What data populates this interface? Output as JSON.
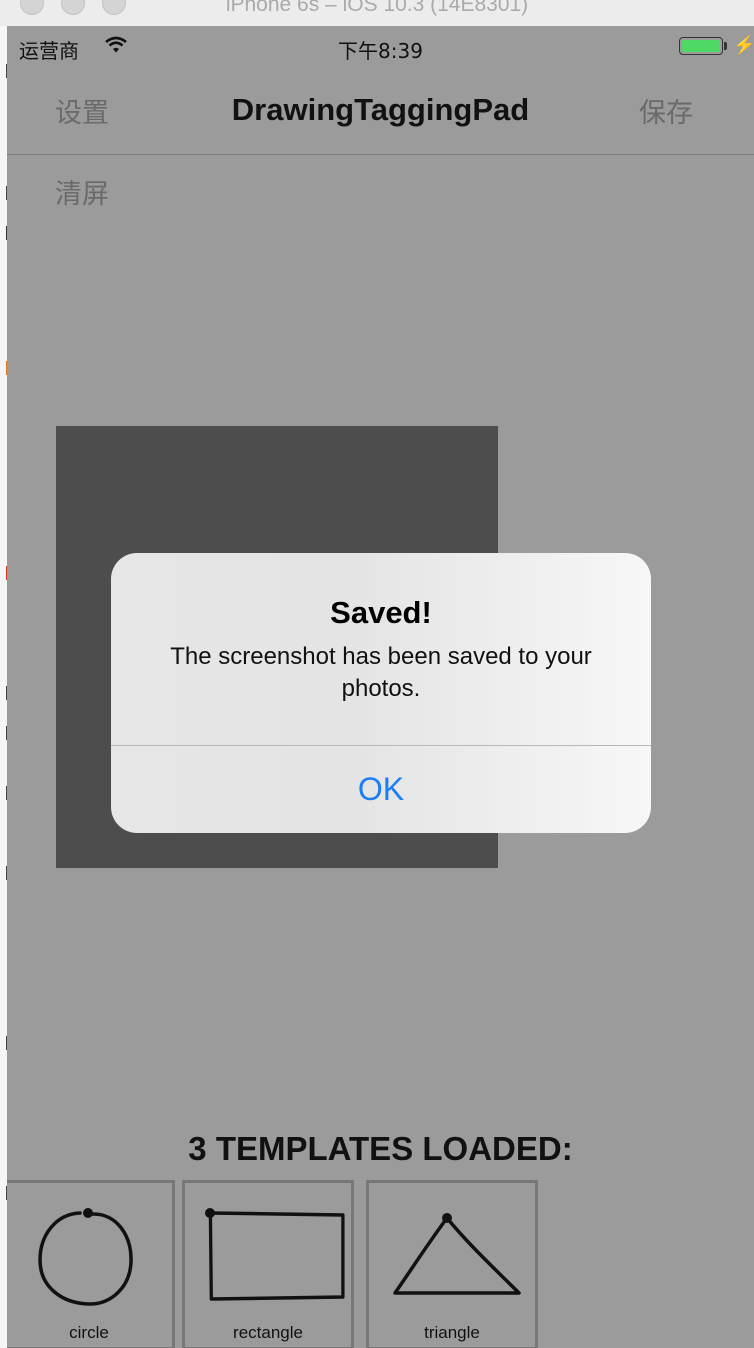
{
  "window": {
    "title": "iPhone 6s – iOS 10.3 (14E8301)"
  },
  "status_bar": {
    "carrier": "运营商",
    "time": "下午8:39",
    "battery_color": "#4cd964"
  },
  "nav": {
    "left": "设置",
    "title": "DrawingTaggingPad",
    "right": "保存"
  },
  "toolbar": {
    "clear": "清屏"
  },
  "templates": {
    "heading": "3 TEMPLATES LOADED:",
    "items": [
      {
        "label": "circle"
      },
      {
        "label": "rectangle"
      },
      {
        "label": "triangle"
      }
    ]
  },
  "alert": {
    "title": "Saved!",
    "message": "The screenshot has been saved to your photos.",
    "ok": "OK",
    "ok_color": "#1a7ef5"
  }
}
